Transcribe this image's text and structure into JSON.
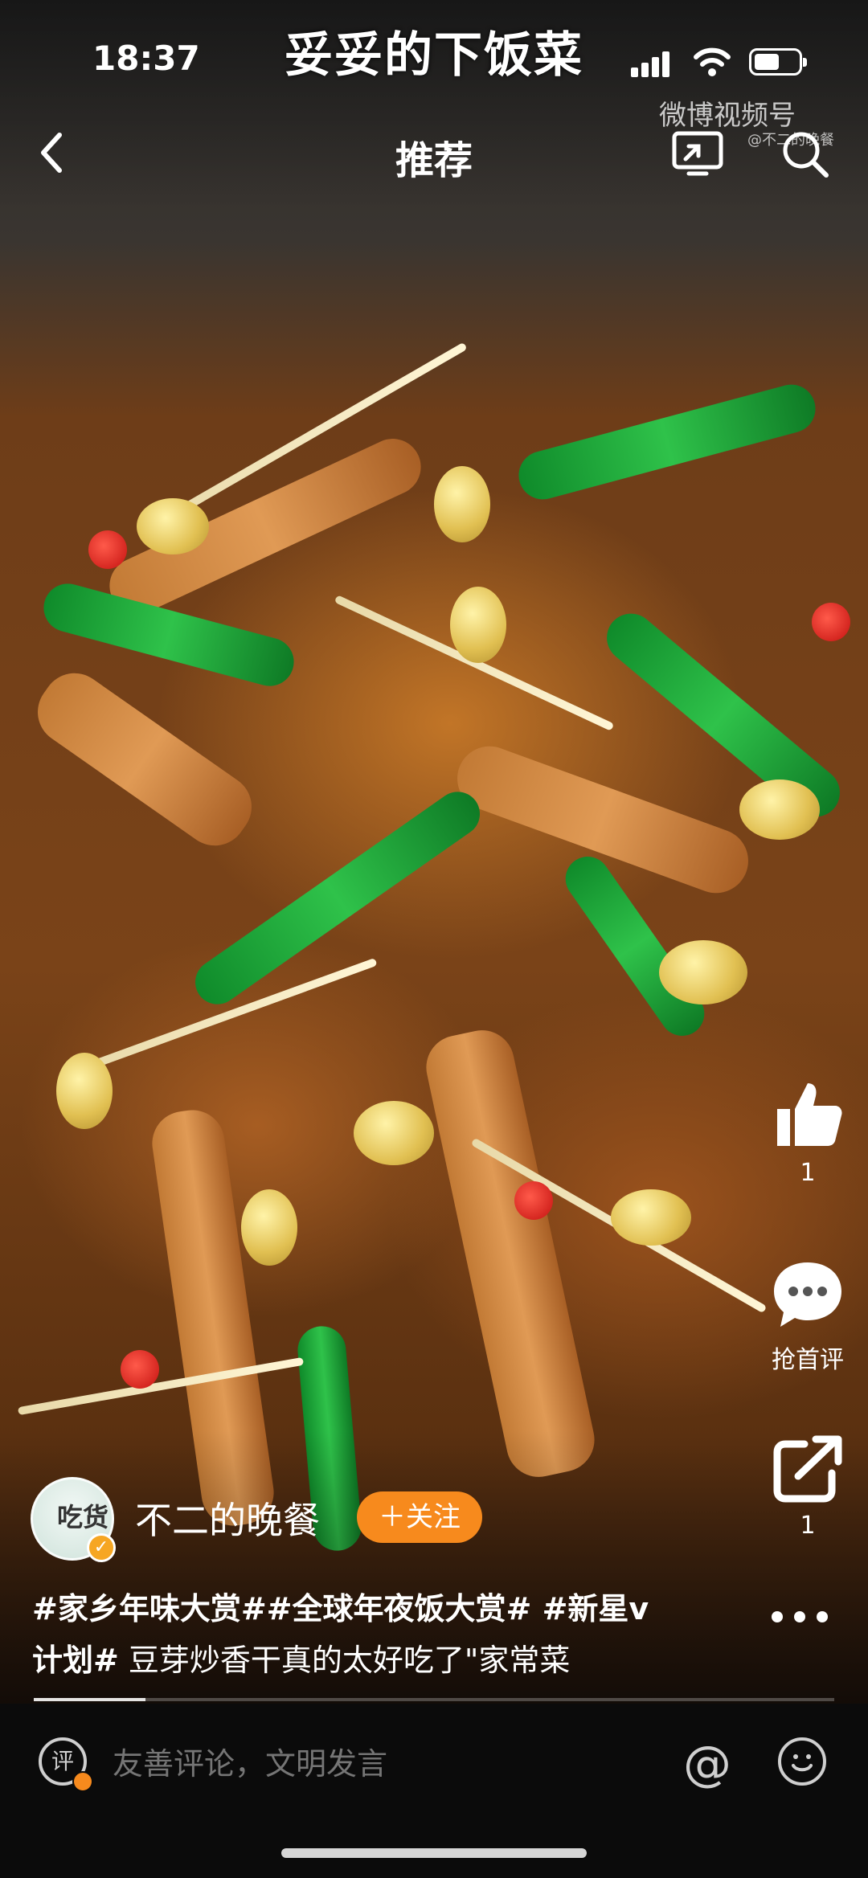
{
  "status_bar": {
    "time": "18:37"
  },
  "video": {
    "caption": "妥妥的下饭菜",
    "watermark": "微博视频号",
    "watermark_sub": "@不二的晚餐"
  },
  "nav": {
    "title": "推荐"
  },
  "rail": {
    "like_count": "1",
    "comment_label": "抢首评",
    "share_count": "1"
  },
  "author": {
    "name": "不二的晚餐",
    "avatar_text": "吃货",
    "follow_label": "＋关注"
  },
  "description": {
    "hashtags": "#家乡年味大赏##全球年夜饭大赏# #新星v计划#",
    "text": " 豆芽炒香干真的太好吃了\"家常菜"
  },
  "progress": {
    "fraction": 0.14
  },
  "comment_bar": {
    "ping_icon_text": "评",
    "placeholder": "友善评论，文明发言"
  },
  "colors": {
    "accent": "#f78a1d",
    "bar_bg": "#0b0b0b"
  }
}
